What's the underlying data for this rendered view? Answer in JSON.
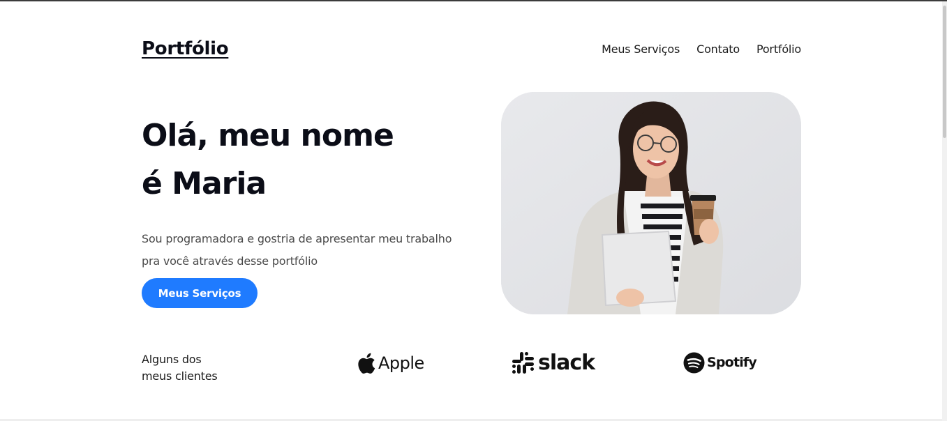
{
  "header": {
    "logo": "Portfólio",
    "nav": [
      {
        "label": "Meus Serviços"
      },
      {
        "label": "Contato"
      },
      {
        "label": "Portfólio"
      }
    ]
  },
  "hero": {
    "title_line1": "Olá, meu nome",
    "title_line2": "é Maria",
    "desc_line1": "Sou programadora e gostria de apresentar meu trabalho",
    "desc_line2": "pra você através desse portfólio",
    "cta_label": "Meus Serviços",
    "photo_icon": "woman-holding-coffee-photo"
  },
  "clients": {
    "label_line1": "Alguns dos",
    "label_line2": "meus clientes",
    "brands": [
      {
        "name": "Apple",
        "icon": "apple-icon"
      },
      {
        "name": "slack",
        "icon": "slack-icon"
      },
      {
        "name": "Spotify",
        "icon": "spotify-icon"
      }
    ]
  },
  "colors": {
    "accent": "#1f7bff",
    "text": "#0b0d17",
    "photo_bg": "#e4e5e8"
  }
}
